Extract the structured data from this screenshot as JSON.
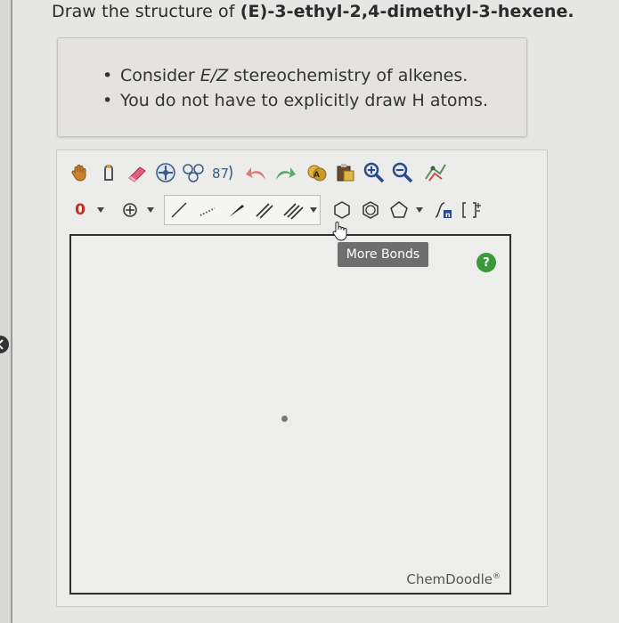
{
  "question": {
    "prefix": "Draw the structure of ",
    "compound": "(E)-3-ethyl-2,4-dimethyl-3-hexene."
  },
  "hints": {
    "items": [
      {
        "lead": "Consider ",
        "em": "E/Z",
        "tail": " stereochemistry of alkenes."
      },
      {
        "lead": "You do not have to explicitly draw H atoms.",
        "em": "",
        "tail": ""
      }
    ]
  },
  "editor": {
    "charge_label": "0",
    "tooltip": "More Bonds",
    "help_label": "?",
    "brand": "ChemDoodle",
    "brand_mark": "®"
  },
  "icons": {
    "row1": [
      "hand-pan-icon",
      "lasso-select-icon",
      "eraser-icon",
      "center-icon",
      "ring-template-icon",
      "atom-label-icon",
      "undo-icon",
      "redo-icon",
      "copy-icon",
      "paste-icon",
      "zoom-in-icon",
      "zoom-out-icon",
      "clean-icon"
    ],
    "row2": [
      "charge-icon",
      "radical-icon",
      "single-bond-icon",
      "dashed-bond-icon",
      "wedge-bond-icon",
      "double-bond-icon",
      "triple-bond-icon",
      "more-bonds-icon",
      "cyclohexane-icon",
      "benzene-icon",
      "cyclopentane-icon",
      "chain-icon",
      "bracket-icon"
    ]
  },
  "colors": {
    "help_green": "#3a9a3a",
    "charge_red": "#c03020",
    "tooltip_bg": "#6e6e6e"
  }
}
